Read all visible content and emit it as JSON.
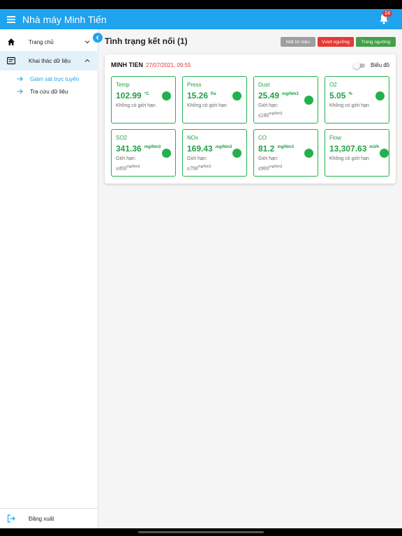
{
  "app": {
    "title": "Nhà máy Minh Tiến",
    "notifications": "24"
  },
  "sidebar": {
    "items": [
      {
        "label": "Trang chủ",
        "icon": "home-icon"
      },
      {
        "label": "Khai thác dữ liệu",
        "icon": "list-icon"
      }
    ],
    "subitems": [
      {
        "label": "Giám sát trực tuyến",
        "active": true
      },
      {
        "label": "Tra cứu dữ liệu",
        "active": false
      }
    ],
    "logout": "Đăng xuất"
  },
  "page": {
    "title": "Tình trạng kết nối (1)",
    "legend": [
      {
        "label": "Mất tín hiệu",
        "color": "#9e9e9e"
      },
      {
        "label": "Vượt ngưỡng",
        "color": "#e53935"
      },
      {
        "label": "Trong ngưỡng",
        "color": "#43a047"
      }
    ]
  },
  "station": {
    "name": "MINH TIEN",
    "time": "27/07/2021, 09:55",
    "chart_toggle": "Biểu đồ",
    "metrics": [
      {
        "name": "Temp",
        "value": "102.99",
        "unit": "°C",
        "limit_label": "Không có giới hạn",
        "limit_value": "",
        "limit_unit": ""
      },
      {
        "name": "Press",
        "value": "15.26",
        "unit": "Pa",
        "limit_label": "Không có giới hạn",
        "limit_value": "",
        "limit_unit": ""
      },
      {
        "name": "Dust",
        "value": "25.49",
        "unit": "mg/Nm3",
        "limit_label": "Giới hạn:",
        "limit_value": "≤180",
        "limit_unit": "mg/Nm3"
      },
      {
        "name": "O2",
        "value": "5.05",
        "unit": "%",
        "limit_label": "Không có giới hạn",
        "limit_value": "",
        "limit_unit": ""
      },
      {
        "name": "SO2",
        "value": "341.36",
        "unit": "mg/Nm3",
        "limit_label": "Giới hạn:",
        "limit_value": "≤450",
        "limit_unit": "mg/Nm3"
      },
      {
        "name": "NOx",
        "value": "169.43",
        "unit": "mg/Nm3",
        "limit_label": "Giới hạn:",
        "limit_value": "≤756",
        "limit_unit": "mg/Nm3"
      },
      {
        "name": "CO",
        "value": "81.2",
        "unit": "mg/Nm3",
        "limit_label": "Giới hạn:",
        "limit_value": "≤900",
        "limit_unit": "mg/Nm3"
      },
      {
        "name": "Flow",
        "value": "13,307.63",
        "unit": "m3/h",
        "limit_label": "Không có giới hạn",
        "limit_value": "",
        "limit_unit": ""
      }
    ]
  }
}
